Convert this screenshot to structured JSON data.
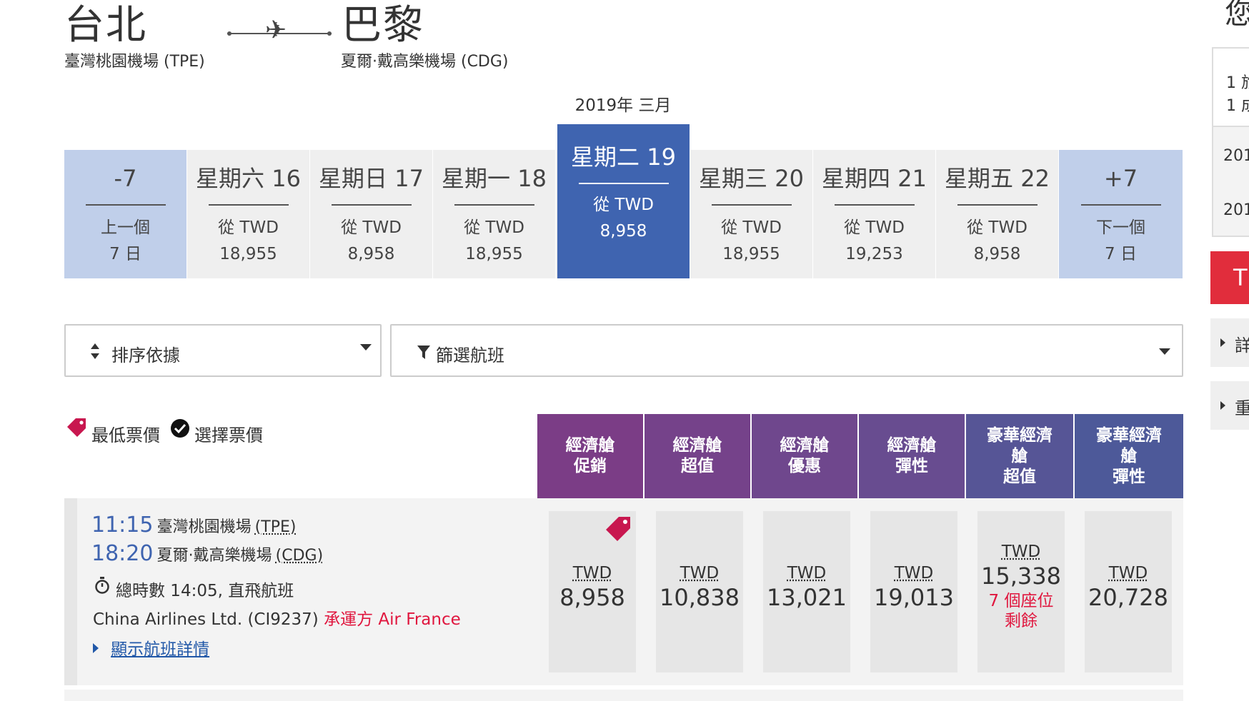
{
  "route": {
    "origin_city": "台北",
    "origin_airport": "臺灣桃園機場 (TPE)",
    "destination_city": "巴黎",
    "destination_airport": "夏爾·戴高樂機場 (CDG)",
    "plane_glyph": "✈"
  },
  "month_label": "2019年 三月",
  "date_strip": {
    "prev": {
      "label": "-7",
      "line1": "上一個",
      "line2": "7 日"
    },
    "next": {
      "label": "+7",
      "line1": "下一個",
      "line2": "7 日"
    },
    "days": [
      {
        "day": "星期六 16",
        "from": "從 TWD",
        "price": "18,955"
      },
      {
        "day": "星期日 17",
        "from": "從 TWD",
        "price": "8,958"
      },
      {
        "day": "星期一 18",
        "from": "從 TWD",
        "price": "18,955"
      },
      {
        "day": "星期二 19",
        "from": "從 TWD",
        "price": "8,958"
      },
      {
        "day": "星期三 20",
        "from": "從 TWD",
        "price": "18,955"
      },
      {
        "day": "星期四 21",
        "from": "從 TWD",
        "price": "19,253"
      },
      {
        "day": "星期五 22",
        "from": "從 TWD",
        "price": "8,958"
      }
    ]
  },
  "controls": {
    "sort_label": "排序依據",
    "filter_label": "篩選航班"
  },
  "legend": {
    "lowest": "最低票價",
    "selected": "選擇票價"
  },
  "fare_columns": [
    {
      "l1": "經濟艙",
      "l2": "促銷",
      "l3": "",
      "color": "#7b3d86"
    },
    {
      "l1": "經濟艙",
      "l2": "超值",
      "l3": "",
      "color": "#75428a"
    },
    {
      "l1": "經濟艙",
      "l2": "優惠",
      "l3": "",
      "color": "#6f478d"
    },
    {
      "l1": "經濟艙",
      "l2": "彈性",
      "l3": "",
      "color": "#684c90"
    },
    {
      "l1": "豪華經濟",
      "l2": "艙",
      "l3": "超值",
      "color": "#565596"
    },
    {
      "l1": "豪華經濟",
      "l2": "艙",
      "l3": "彈性",
      "color": "#4d5999"
    }
  ],
  "flight": {
    "dep_time": "11:15",
    "dep_airport": "臺灣桃園機場",
    "dep_code": "(TPE)",
    "arr_time": "18:20",
    "arr_airport": "夏爾·戴高樂機場",
    "arr_code": "(CDG)",
    "duration": "總時數 14:05, 直飛航班",
    "carrier": "China Airlines Ltd. (CI9237)",
    "operated_by": "承運方 Air France",
    "details_link": "顯示航班詳情",
    "fares": [
      {
        "currency": "TWD",
        "amount": "8,958",
        "note1": "",
        "note2": ""
      },
      {
        "currency": "TWD",
        "amount": "10,838",
        "note1": "",
        "note2": ""
      },
      {
        "currency": "TWD",
        "amount": "13,021",
        "note1": "",
        "note2": ""
      },
      {
        "currency": "TWD",
        "amount": "19,013",
        "note1": "",
        "note2": ""
      },
      {
        "currency": "TWD",
        "amount": "15,338",
        "note1": "7 個座位",
        "note2": "剩餘"
      },
      {
        "currency": "TWD",
        "amount": "20,728",
        "note1": "",
        "note2": ""
      }
    ]
  },
  "sidebar": {
    "top_char": "您",
    "p1": "1 旅",
    "p2": "1 成",
    "d1": "201",
    "d2": "201",
    "btn": "T",
    "item1": "詳",
    "item2": "重"
  },
  "colors": {
    "selected_day": "#3f64b0",
    "nav_day": "#c0cfea",
    "tag_red": "#c8174f",
    "sidebar_red": "#e12d3c"
  }
}
